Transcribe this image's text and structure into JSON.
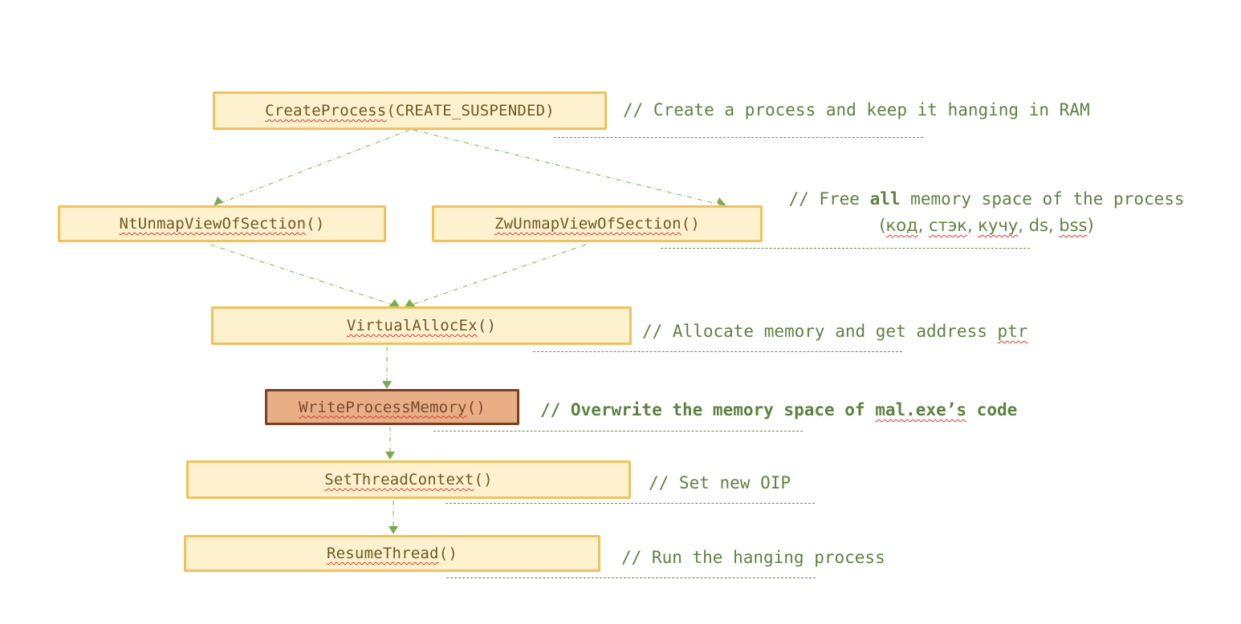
{
  "nodes": {
    "create_process": {
      "func": "CreateProcess",
      "args": "(CREATE_SUSPENDED)"
    },
    "nt_unmap": {
      "func": "NtUnmapViewOfSection",
      "args": "()"
    },
    "zw_unmap": {
      "func": "ZwUnmapViewOfSection",
      "args": "()"
    },
    "virtual_alloc": {
      "func": "VirtualAllocEx",
      "args": "()"
    },
    "write_memory": {
      "func": "WriteProcessMemory",
      "args": "()"
    },
    "set_context": {
      "func": "SetThreadContext",
      "args": "()"
    },
    "resume_thread": {
      "func": "ResumeThread",
      "args": "()"
    }
  },
  "comments": {
    "create_process": "// Create a process and keep it hanging in RAM",
    "unmap": {
      "prefix": "// Free ",
      "bold": "all",
      "suffix": " memory space of the process",
      "line2_open": "(",
      "line2_items": [
        "код",
        "стэк",
        "кучу",
        "ds",
        "bss"
      ],
      "line2_sep": ", ",
      "line2_close": ")"
    },
    "virtual_alloc": {
      "text": "// Allocate memory and get address ",
      "flagged": "ptr"
    },
    "write_memory": {
      "prefix": "// Overwrite the memory space of ",
      "flagged": "mal.exe’s",
      "suffix": " code"
    },
    "set_context": "// Set new OIP",
    "resume_thread": "// Run the hanging process"
  },
  "colors": {
    "node_fill": "#fdf1cf",
    "node_border": "#f3c257",
    "highlight_fill": "#e8ae86",
    "highlight_border": "#7a4020",
    "comment_text": "#5f8240",
    "arrow": "#7aab50",
    "spellcheck": "#e0362a"
  }
}
